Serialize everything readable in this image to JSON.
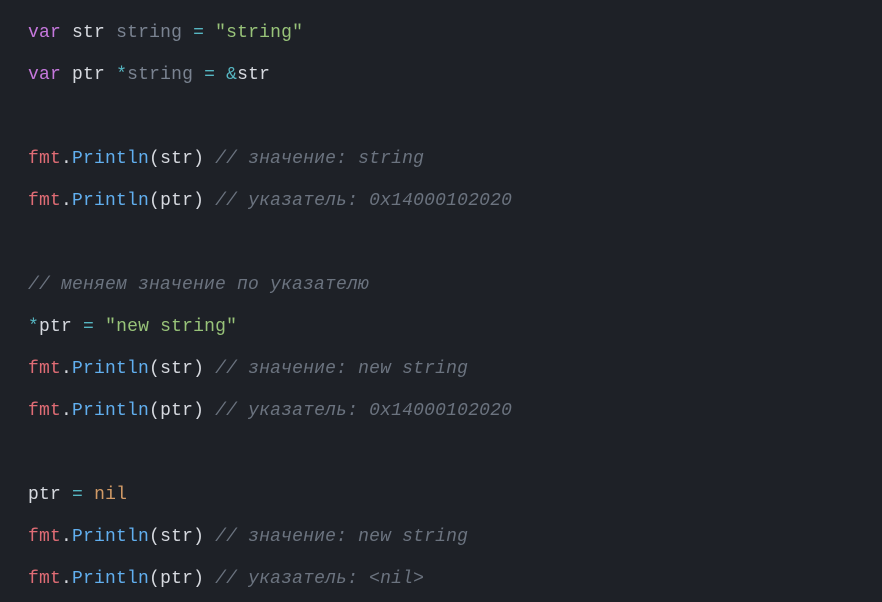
{
  "tokens": [
    [
      {
        "c": "kw",
        "t": "var"
      },
      {
        "c": "",
        "t": " "
      },
      {
        "c": "wht",
        "t": "str"
      },
      {
        "c": "",
        "t": " "
      },
      {
        "c": "typ",
        "t": "string"
      },
      {
        "c": "",
        "t": " "
      },
      {
        "c": "op",
        "t": "="
      },
      {
        "c": "",
        "t": " "
      },
      {
        "c": "str",
        "t": "\"string\""
      }
    ],
    [
      {
        "c": "kw",
        "t": "var"
      },
      {
        "c": "",
        "t": " "
      },
      {
        "c": "wht",
        "t": "ptr"
      },
      {
        "c": "",
        "t": " "
      },
      {
        "c": "op",
        "t": "*"
      },
      {
        "c": "typ",
        "t": "string"
      },
      {
        "c": "",
        "t": " "
      },
      {
        "c": "op",
        "t": "="
      },
      {
        "c": "",
        "t": " "
      },
      {
        "c": "op",
        "t": "&"
      },
      {
        "c": "wht",
        "t": "str"
      }
    ],
    [],
    [
      {
        "c": "id",
        "t": "fmt"
      },
      {
        "c": "punc",
        "t": "."
      },
      {
        "c": "fn",
        "t": "Println"
      },
      {
        "c": "punc",
        "t": "("
      },
      {
        "c": "wht",
        "t": "str"
      },
      {
        "c": "punc",
        "t": ")"
      },
      {
        "c": "",
        "t": " "
      },
      {
        "c": "cm",
        "t": "// значение: string"
      }
    ],
    [
      {
        "c": "id",
        "t": "fmt"
      },
      {
        "c": "punc",
        "t": "."
      },
      {
        "c": "fn",
        "t": "Println"
      },
      {
        "c": "punc",
        "t": "("
      },
      {
        "c": "wht",
        "t": "ptr"
      },
      {
        "c": "punc",
        "t": ")"
      },
      {
        "c": "",
        "t": " "
      },
      {
        "c": "cm",
        "t": "// указатель: 0x14000102020"
      }
    ],
    [],
    [
      {
        "c": "cm",
        "t": "// меняем значение по указателю"
      }
    ],
    [
      {
        "c": "op",
        "t": "*"
      },
      {
        "c": "wht",
        "t": "ptr"
      },
      {
        "c": "",
        "t": " "
      },
      {
        "c": "op",
        "t": "="
      },
      {
        "c": "",
        "t": " "
      },
      {
        "c": "str",
        "t": "\"new string\""
      }
    ],
    [
      {
        "c": "id",
        "t": "fmt"
      },
      {
        "c": "punc",
        "t": "."
      },
      {
        "c": "fn",
        "t": "Println"
      },
      {
        "c": "punc",
        "t": "("
      },
      {
        "c": "wht",
        "t": "str"
      },
      {
        "c": "punc",
        "t": ")"
      },
      {
        "c": "",
        "t": " "
      },
      {
        "c": "cm",
        "t": "// значение: new string"
      }
    ],
    [
      {
        "c": "id",
        "t": "fmt"
      },
      {
        "c": "punc",
        "t": "."
      },
      {
        "c": "fn",
        "t": "Println"
      },
      {
        "c": "punc",
        "t": "("
      },
      {
        "c": "wht",
        "t": "ptr"
      },
      {
        "c": "punc",
        "t": ")"
      },
      {
        "c": "",
        "t": " "
      },
      {
        "c": "cm",
        "t": "// указатель: 0x14000102020"
      }
    ],
    [],
    [
      {
        "c": "wht",
        "t": "ptr"
      },
      {
        "c": "",
        "t": " "
      },
      {
        "c": "op",
        "t": "="
      },
      {
        "c": "",
        "t": " "
      },
      {
        "c": "con",
        "t": "nil"
      }
    ],
    [
      {
        "c": "id",
        "t": "fmt"
      },
      {
        "c": "punc",
        "t": "."
      },
      {
        "c": "fn",
        "t": "Println"
      },
      {
        "c": "punc",
        "t": "("
      },
      {
        "c": "wht",
        "t": "str"
      },
      {
        "c": "punc",
        "t": ")"
      },
      {
        "c": "",
        "t": " "
      },
      {
        "c": "cm",
        "t": "// значение: new string"
      }
    ],
    [
      {
        "c": "id",
        "t": "fmt"
      },
      {
        "c": "punc",
        "t": "."
      },
      {
        "c": "fn",
        "t": "Println"
      },
      {
        "c": "punc",
        "t": "("
      },
      {
        "c": "wht",
        "t": "ptr"
      },
      {
        "c": "punc",
        "t": ")"
      },
      {
        "c": "",
        "t": " "
      },
      {
        "c": "cm",
        "t": "// указатель: <nil>"
      }
    ]
  ]
}
